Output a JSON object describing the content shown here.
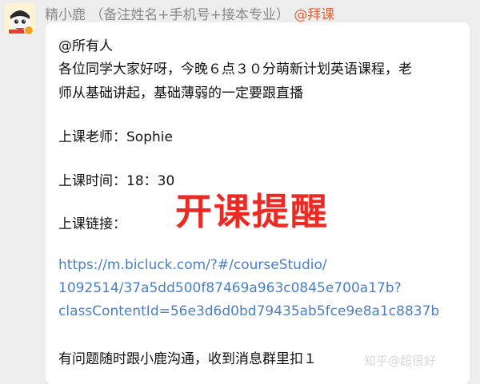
{
  "sender": {
    "name": "精小鹿",
    "note": "（备注姓名+手机号+接本专业）",
    "mention": "@拜课"
  },
  "message": {
    "mention_all": "@所有人",
    "greeting_line1": "各位同学大家好呀，今晚６点３０分萌新计划英语课程，老",
    "greeting_line2": "师从基础讲起，基础薄弱的一定要跟直播",
    "teacher": "上课老师：Sophie",
    "time": "上课时间：18：30",
    "link_label": "上课链接：",
    "link_line1": "https://m.bicluck.com/?#/courseStudio/",
    "link_line2": "1092514/37a5dd500f87469a963c0845e700a17b?",
    "link_line3": "classContentId=56e3d6d0bd79435ab5fce9e8a1c8837b",
    "footer": "有问题随时跟小鹿沟通，收到消息群里扣１"
  },
  "stamp": "开课提醒",
  "watermark": "知乎@超很好",
  "colors": {
    "link": "#4a7fc1",
    "stamp": "#ec2a24",
    "mention": "#e0673d",
    "background": "#ededed"
  }
}
